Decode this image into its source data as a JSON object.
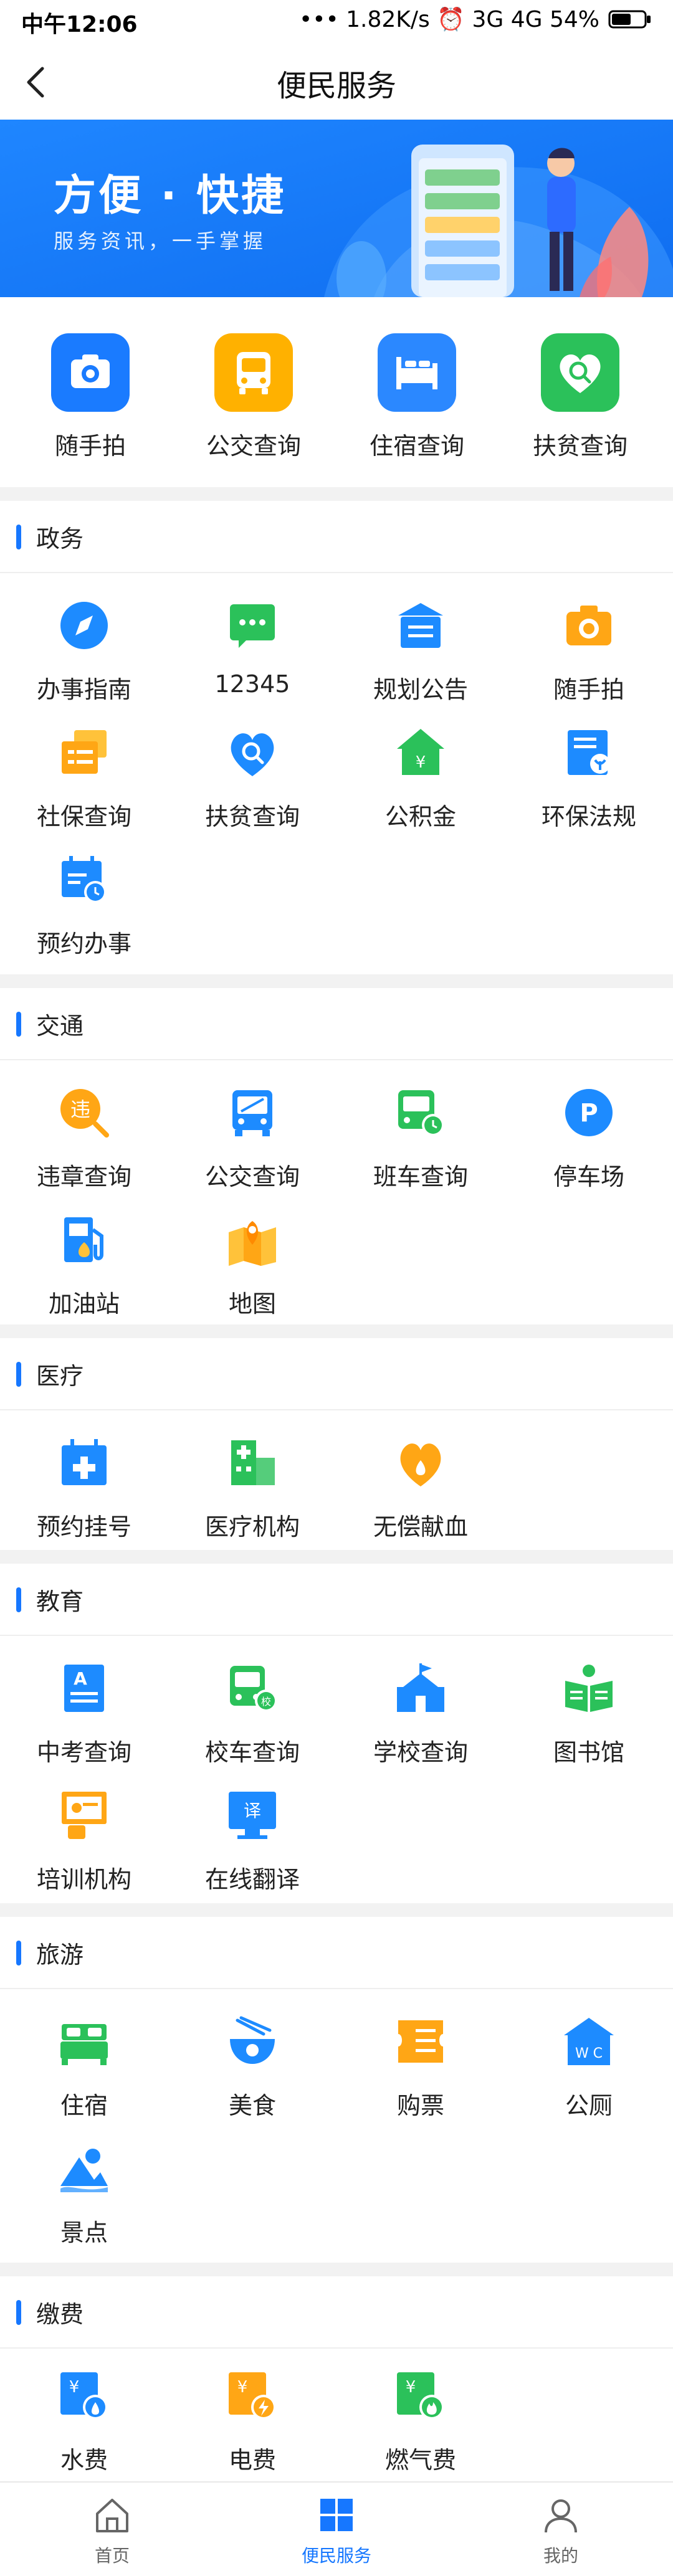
{
  "status_bar": {
    "time": "中午12:06",
    "right": "••• 1.82K/s ⏰ 3G 4G 54%"
  },
  "nav": {
    "title": "便民服务"
  },
  "banner": {
    "title": "方便 · 快捷",
    "subtitle": "服务资讯，一手掌握"
  },
  "quick": [
    {
      "label": "随手拍",
      "icon": "camera-icon",
      "color": "#1a7bff"
    },
    {
      "label": "公交查询",
      "icon": "bus-icon",
      "color": "#ffb100"
    },
    {
      "label": "住宿查询",
      "icon": "bed-icon",
      "color": "#2b88ff"
    },
    {
      "label": "扶贫查询",
      "icon": "heart-search-icon",
      "color": "#2bc15a"
    }
  ],
  "sections": [
    {
      "title": "政务",
      "items": [
        {
          "label": "办事指南",
          "icon": "compass-icon"
        },
        {
          "label": "12345",
          "icon": "chat-icon"
        },
        {
          "label": "规划公告",
          "icon": "notice-icon"
        },
        {
          "label": "随手拍",
          "icon": "camera-icon"
        },
        {
          "label": "社保查询",
          "icon": "social-security-icon"
        },
        {
          "label": "扶贫查询",
          "icon": "heart-search-icon"
        },
        {
          "label": "公积金",
          "icon": "fund-house-icon"
        },
        {
          "label": "环保法规",
          "icon": "eco-regulation-icon"
        },
        {
          "label": "预约办事",
          "icon": "calendar-clock-icon"
        }
      ]
    },
    {
      "title": "交通",
      "items": [
        {
          "label": "违章查询",
          "icon": "violation-search-icon"
        },
        {
          "label": "公交查询",
          "icon": "bus-icon"
        },
        {
          "label": "班车查询",
          "icon": "shuttle-clock-icon"
        },
        {
          "label": "停车场",
          "icon": "parking-icon"
        },
        {
          "label": "加油站",
          "icon": "gas-station-icon"
        },
        {
          "label": "地图",
          "icon": "map-icon"
        }
      ]
    },
    {
      "title": "医疗",
      "items": [
        {
          "label": "预约挂号",
          "icon": "medical-calendar-icon"
        },
        {
          "label": "医疗机构",
          "icon": "hospital-icon"
        },
        {
          "label": "无偿献血",
          "icon": "blood-drop-icon"
        }
      ]
    },
    {
      "title": "教育",
      "items": [
        {
          "label": "中考查询",
          "icon": "exam-icon"
        },
        {
          "label": "校车查询",
          "icon": "school-bus-icon"
        },
        {
          "label": "学校查询",
          "icon": "school-icon"
        },
        {
          "label": "图书馆",
          "icon": "library-icon"
        },
        {
          "label": "培训机构",
          "icon": "training-icon"
        },
        {
          "label": "在线翻译",
          "icon": "translate-icon"
        }
      ]
    },
    {
      "title": "旅游",
      "items": [
        {
          "label": "住宿",
          "icon": "bed-icon"
        },
        {
          "label": "美食",
          "icon": "food-icon"
        },
        {
          "label": "购票",
          "icon": "ticket-icon"
        },
        {
          "label": "公厕",
          "icon": "toilet-icon"
        },
        {
          "label": "景点",
          "icon": "scenic-icon"
        }
      ]
    },
    {
      "title": "缴费",
      "items": [
        {
          "label": "水费",
          "icon": "water-bill-icon"
        },
        {
          "label": "电费",
          "icon": "electric-bill-icon"
        },
        {
          "label": "燃气费",
          "icon": "gas-bill-icon"
        }
      ]
    }
  ],
  "tabbar": [
    {
      "label": "首页",
      "icon": "home-icon",
      "active": false
    },
    {
      "label": "便民服务",
      "icon": "grid-icon",
      "active": true
    },
    {
      "label": "我的",
      "icon": "user-icon",
      "active": false
    }
  ],
  "colors": {
    "accent": "#1677ff",
    "section_gap": "#f2f2f2"
  }
}
